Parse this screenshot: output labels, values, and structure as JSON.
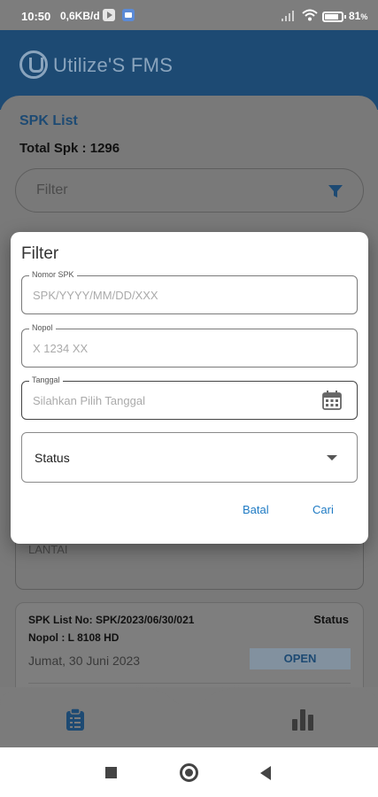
{
  "status_bar": {
    "time": "10:50",
    "speed": "0,6KB/d",
    "battery": "81",
    "battery_suffix": "%"
  },
  "app": {
    "brand": "Utilize'S FMS",
    "brand_color": "#1d4a73"
  },
  "page": {
    "title": "SPK List",
    "total_label": "Total Spk : 1296",
    "filter_placeholder": "Filter",
    "icons": [
      "filter-icon"
    ]
  },
  "card_behind": {
    "text": "LANTAI"
  },
  "spk_card": {
    "spk_no": "SPK List No: SPK/2023/06/30/021",
    "status_header": "Status",
    "nopol": "Nopol : L 8108 HD",
    "date": "Jumat, 30 Juni 2023",
    "status_value": "OPEN"
  },
  "dialog": {
    "title": "Filter",
    "fields": [
      {
        "label": "Nomor SPK",
        "placeholder": "SPK/YYYY/MM/DD/XXX"
      },
      {
        "label": "Nopol",
        "placeholder": "X 1234 XX"
      },
      {
        "label": "Tanggal",
        "placeholder": "Silahkan Pilih Tanggal"
      }
    ],
    "status_select": "Status",
    "cancel_label": "Batal",
    "search_label": "Cari",
    "accent_color": "#1f7bc4"
  },
  "bottom_nav": {
    "icons": [
      "clipboard-icon",
      "bar-chart-icon"
    ]
  },
  "system_nav": {
    "icons": [
      "recents-icon",
      "home-icon",
      "back-icon"
    ]
  }
}
